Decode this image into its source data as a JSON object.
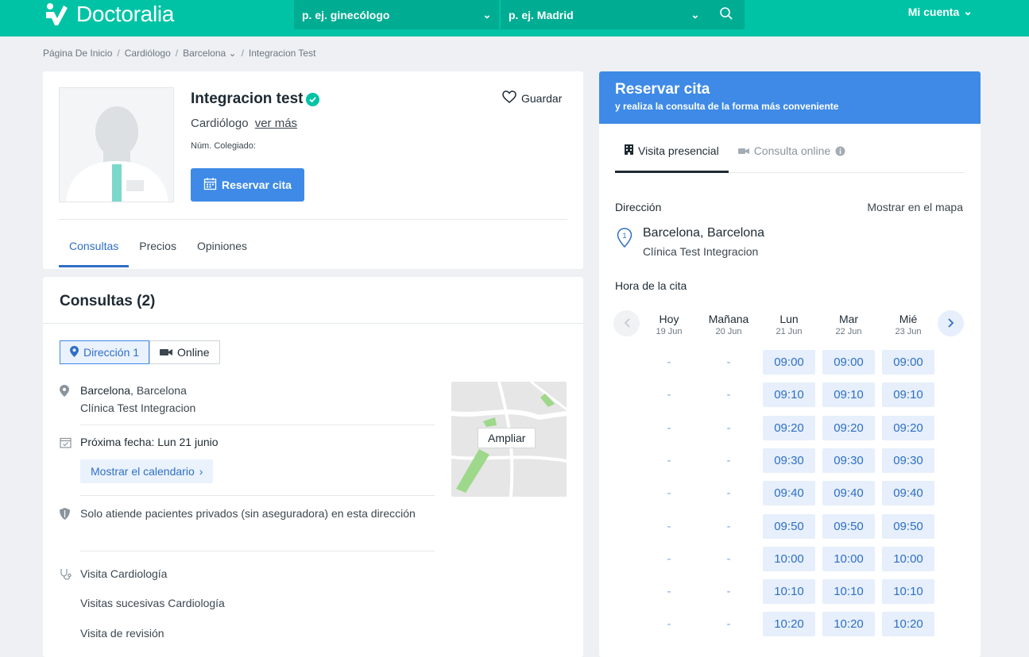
{
  "header": {
    "logo": "Doctoralia",
    "spec_placeholder": "p. ej. ginecólogo",
    "loc_placeholder": "p. ej. Madrid",
    "account": "Mi cuenta"
  },
  "breadcrumb": [
    "Página De Inicio",
    "/",
    "Cardiólogo",
    "/",
    "Barcelona",
    "/",
    "Integracion Test"
  ],
  "profile": {
    "name": "Integracion test",
    "specialty": "Cardiólogo",
    "more": "ver más",
    "colegiado": "Núm. Colegiado:",
    "book_btn": "Reservar cita",
    "save": "Guardar",
    "tabs": [
      "Consultas",
      "Precios",
      "Opiniones"
    ]
  },
  "consultas": {
    "title": "Consultas (2)",
    "seg_address": "Dirección 1",
    "seg_online": "Online",
    "city_bold": "Barcelona",
    "city_rest": ", Barcelona",
    "clinic": "Clínica Test Integracion",
    "next_label": "Próxima fecha:",
    "next_value": "Lun 21 junio",
    "calendar_btn": "Mostrar el calendario",
    "insurance": "Solo atiende pacientes privados (sin aseguradora) en esta dirección",
    "map_btn": "Ampliar",
    "services": [
      "Visita Cardiología",
      "Visitas sucesivas Cardiología",
      "Visita de revisión"
    ]
  },
  "booking": {
    "title": "Reservar cita",
    "subtitle": "y realiza la consulta de la forma más conveniente",
    "tab_presencial": "Visita presencial",
    "tab_online": "Consulta online",
    "address_label": "Dirección",
    "map_link": "Mostrar en el mapa",
    "pin_number": "1",
    "addr_line1": "Barcelona, Barcelona",
    "addr_line2": "Clínica Test Integracion",
    "time_label": "Hora de la cita",
    "days": [
      {
        "name": "Hoy",
        "date": "19 Jun"
      },
      {
        "name": "Mañana",
        "date": "20 Jun"
      },
      {
        "name": "Lun",
        "date": "21 Jun"
      },
      {
        "name": "Mar",
        "date": "22 Jun"
      },
      {
        "name": "Mié",
        "date": "23 Jun"
      }
    ],
    "times": [
      "09:00",
      "09:10",
      "09:20",
      "09:30",
      "09:40",
      "09:50",
      "10:00",
      "10:10",
      "10:20"
    ],
    "empty_mark": "-"
  },
  "colors": {
    "brand": "#00c3a5",
    "primary": "#3e8ae6",
    "link": "#2f6fc5"
  }
}
